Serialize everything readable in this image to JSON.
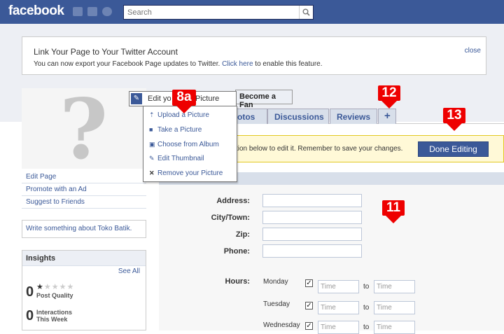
{
  "topbar": {
    "logo": "facebook",
    "search_placeholder": "Search"
  },
  "notice": {
    "title": "Link Your Page to Your Twitter Account",
    "text_before": "You can now export your Facebook Page updates to Twitter. ",
    "link": "Click here",
    "text_after": " to enable this feature.",
    "close": "close"
  },
  "profile": {
    "edit_picture": "Edit your Profile Picture",
    "edit_picture_visible": "Edit yo",
    "edit_picture_tail": "Picture",
    "become_fan": "Become a Fan"
  },
  "dropdown": {
    "items": [
      {
        "icon": "upload-icon",
        "label": "Upload a Picture"
      },
      {
        "icon": "camera-icon",
        "label": "Take a Picture"
      },
      {
        "icon": "album-icon",
        "label": "Choose from Album"
      },
      {
        "icon": "pencil-icon",
        "label": "Edit Thumbnail"
      },
      {
        "icon": "x-icon",
        "label": "Remove your Picture"
      }
    ]
  },
  "tabs": [
    {
      "label": "otos"
    },
    {
      "label": "Discussions"
    },
    {
      "label": "Reviews"
    },
    {
      "label": "+"
    }
  ],
  "left_nav": {
    "items": [
      "Edit Page",
      "Promote with an Ad",
      "Suggest to Friends"
    ],
    "write": "Write something about Toko Batik."
  },
  "insights": {
    "title": "Insights",
    "see_all": "See All",
    "post_quality_value": "0",
    "post_quality_label": "Post Quality",
    "interactions_value": "0",
    "interactions_label1": "Interactions",
    "interactions_label2": "This Week"
  },
  "edit_bar": {
    "text": "ction below to edit it. Remember to save your changes.",
    "done": "Done Editing"
  },
  "form": {
    "address_label": "Address:",
    "city_label": "City/Town:",
    "zip_label": "Zip:",
    "phone_label": "Phone:",
    "hours_label": "Hours:",
    "days": [
      "Monday",
      "Tuesday",
      "Wednesday"
    ],
    "time_placeholder": "Time",
    "to": "to"
  },
  "callouts": {
    "c8a": "8a",
    "c11": "11",
    "c12": "12",
    "c13": "13"
  },
  "colors": {
    "brand": "#3b5998",
    "callout": "#e00000"
  }
}
